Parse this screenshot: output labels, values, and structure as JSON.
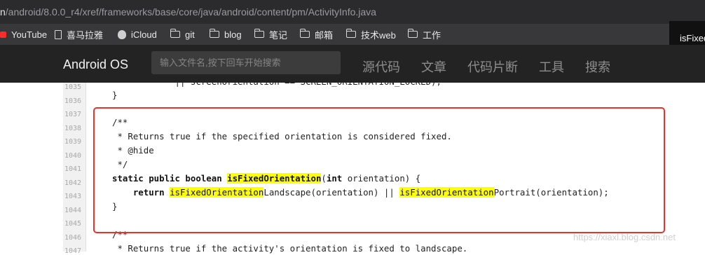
{
  "browser": {
    "url_prefix": "n",
    "url_rest": "/android/8.0.0_r4/xref/frameworks/base/core/java/android/content/pm/ActivityInfo.java"
  },
  "bookmarks": [
    {
      "label": "YouTube",
      "icon": "youtube-icon"
    },
    {
      "label": "喜马拉雅",
      "icon": "document-icon"
    },
    {
      "label": "iCloud",
      "icon": "apple-icon"
    },
    {
      "label": "git",
      "icon": "folder-icon"
    },
    {
      "label": "blog",
      "icon": "folder-icon"
    },
    {
      "label": "笔记",
      "icon": "folder-icon"
    },
    {
      "label": "邮箱",
      "icon": "folder-icon"
    },
    {
      "label": "技术web",
      "icon": "folder-icon"
    },
    {
      "label": "工作",
      "icon": "folder-icon"
    }
  ],
  "tab_popup": "isFixed",
  "nav": {
    "brand": "Android OS",
    "search_placeholder": "输入文件名,按下回车开始搜索",
    "links": [
      "源代码",
      "文章",
      "代码片断",
      "工具",
      "搜索"
    ]
  },
  "code": {
    "line_numbers": [
      "1035",
      "1036",
      "1037",
      "1038",
      "1039",
      "1040",
      "1041",
      "1042",
      "1043",
      "1044",
      "1045",
      "1046",
      "1047"
    ],
    "lines": [
      "            || screenOrientation == SCREEN_ORIENTATION_LOCKED);",
      "}",
      "",
      "/**",
      " * Returns true if the specified orientation is considered fixed.",
      " * @hide",
      " */",
      "",
      "",
      "}",
      "",
      "/**",
      " * Returns true if the activity's orientation is fixed to landscape."
    ],
    "line_1042": {
      "kw": "static public boolean",
      "sp1": " ",
      "hl": "isFixedOrientation",
      "paren_open": "(",
      "kw_int": "int",
      "rest": " orientation) {"
    },
    "line_1043": {
      "indent": "    ",
      "kw": "return",
      "sp1": " ",
      "hl1": "isFixedOrientation",
      "t1": "Landscape(orientation) || ",
      "hl2": "isFixedOrientation",
      "t2": "Portrait(orientation);"
    }
  },
  "watermark": "https://xiaxl.blog.csdn.net",
  "colors": {
    "highlight": "#ffff00",
    "annotation_box": "#e8322a"
  }
}
